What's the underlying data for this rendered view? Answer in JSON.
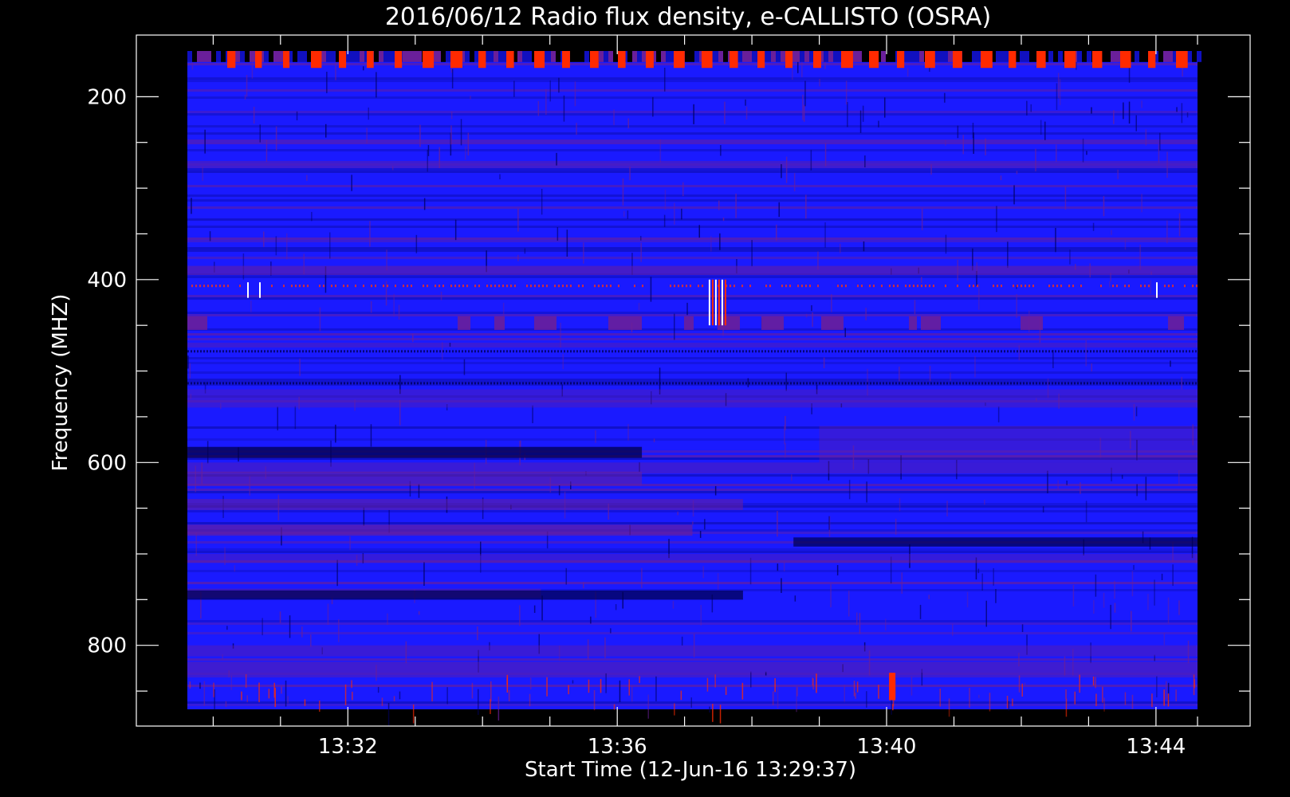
{
  "chart_data": {
    "type": "heatmap",
    "title": "2016/06/12  Radio flux density, e-CALLISTO (OSRA)",
    "xlabel": "Start Time (12-Jun-16 13:29:37)",
    "ylabel": "Frequency (MHZ)",
    "x_range": [
      "13:29:37",
      "13:44:37"
    ],
    "y_range": [
      150,
      870
    ],
    "y_inverted": true,
    "x_ticks": [
      "13:32",
      "13:36",
      "13:40",
      "13:44"
    ],
    "y_ticks": [
      "200",
      "400",
      "600",
      "800"
    ],
    "colors": {
      "background": "#000000",
      "axes": "#ffffff",
      "low": "#1a1aff",
      "mid": "#6a1f9a",
      "high": "#ff2a00",
      "peak": "#ffffff"
    },
    "features": [
      {
        "label": "strong periodic emission",
        "freq_mhz": [
          150,
          172
        ]
      },
      {
        "label": "interference band",
        "freq_mhz": [
          403,
          420
        ]
      },
      {
        "label": "burst",
        "time": "13:37:30",
        "freq_mhz": [
          400,
          450
        ]
      },
      {
        "label": "periodic band",
        "freq_mhz": [
          440,
          455
        ]
      },
      {
        "label": "dark band",
        "freq_mhz": [
          583,
          595
        ]
      },
      {
        "label": "dark band",
        "freq_mhz": [
          740,
          750
        ]
      },
      {
        "label": "burst",
        "time": "13:40:05",
        "freq_mhz": [
          830,
          860
        ]
      }
    ]
  }
}
